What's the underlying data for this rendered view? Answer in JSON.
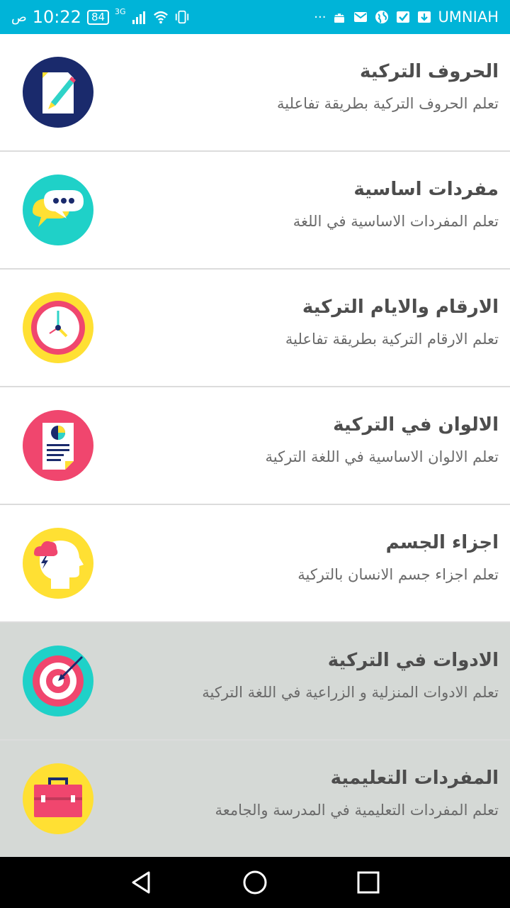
{
  "status_bar": {
    "time": "10:22",
    "ampm": "ص",
    "battery": "84",
    "network": "3G",
    "carrier": "UMNIAH",
    "overflow": "···",
    "icons": [
      "vibrate-icon",
      "wifi-icon",
      "signal-icon",
      "android-icon",
      "mail-icon",
      "globe-icon",
      "check-icon",
      "download-icon"
    ]
  },
  "items": [
    {
      "title": "الحروف التركية",
      "subtitle": "تعلم الحروف التركية بطريقة تفاعلية",
      "icon": "pencil-document-icon",
      "bg": "#1a2a6c"
    },
    {
      "title": "مفردات اساسية",
      "subtitle": "تعلم المفردات الاساسية في اللغة",
      "icon": "chat-bubbles-icon",
      "bg": "#1fd1c8"
    },
    {
      "title": "الارقام والايام التركية",
      "subtitle": "تعلم الارقام التركية بطريقة تفاعلية",
      "icon": "clock-icon",
      "bg": "#ffe033"
    },
    {
      "title": "الالوان في التركية",
      "subtitle": "تعلم الالوان الاساسية في اللغة التركية",
      "icon": "report-chart-icon",
      "bg": "#f0466e"
    },
    {
      "title": "اجزاء الجسم",
      "subtitle": "تعلم اجزاء جسم الانسان بالتركية",
      "icon": "head-storm-icon",
      "bg": "#ffe033"
    },
    {
      "title": "الادوات في التركية",
      "subtitle": "تعلم الادوات المنزلية و الزراعية في اللغة التركية",
      "icon": "target-icon",
      "bg": "#1fd1c8"
    },
    {
      "title": "المفردات التعليمية",
      "subtitle": "تعلم المفردات التعليمية في المدرسة والجامعة",
      "icon": "briefcase-icon",
      "bg": "#ffe033"
    }
  ],
  "selected_indices": [
    5,
    6
  ],
  "nav": {
    "buttons": [
      "back-icon",
      "home-icon",
      "recents-icon"
    ]
  }
}
